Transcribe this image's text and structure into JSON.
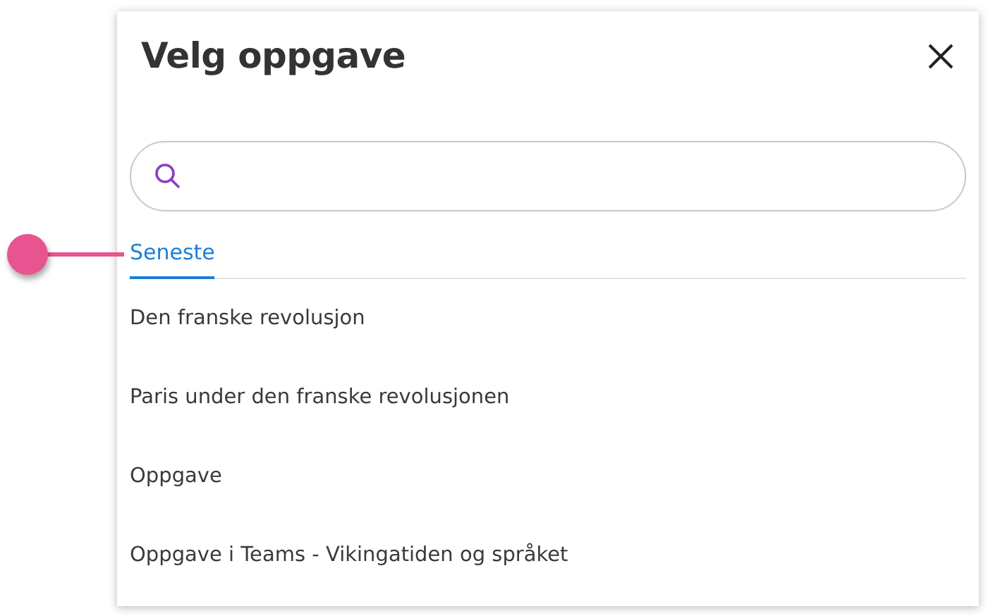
{
  "dialog": {
    "title": "Velg oppgave"
  },
  "tabs": [
    {
      "label": "Seneste",
      "selected": true
    }
  ],
  "items": [
    {
      "label": "Den franske revolusjon"
    },
    {
      "label": "Paris under den franske revolusjonen"
    },
    {
      "label": "Oppgave"
    },
    {
      "label": "Oppgave i Teams - Vikingatiden og språket"
    }
  ]
}
